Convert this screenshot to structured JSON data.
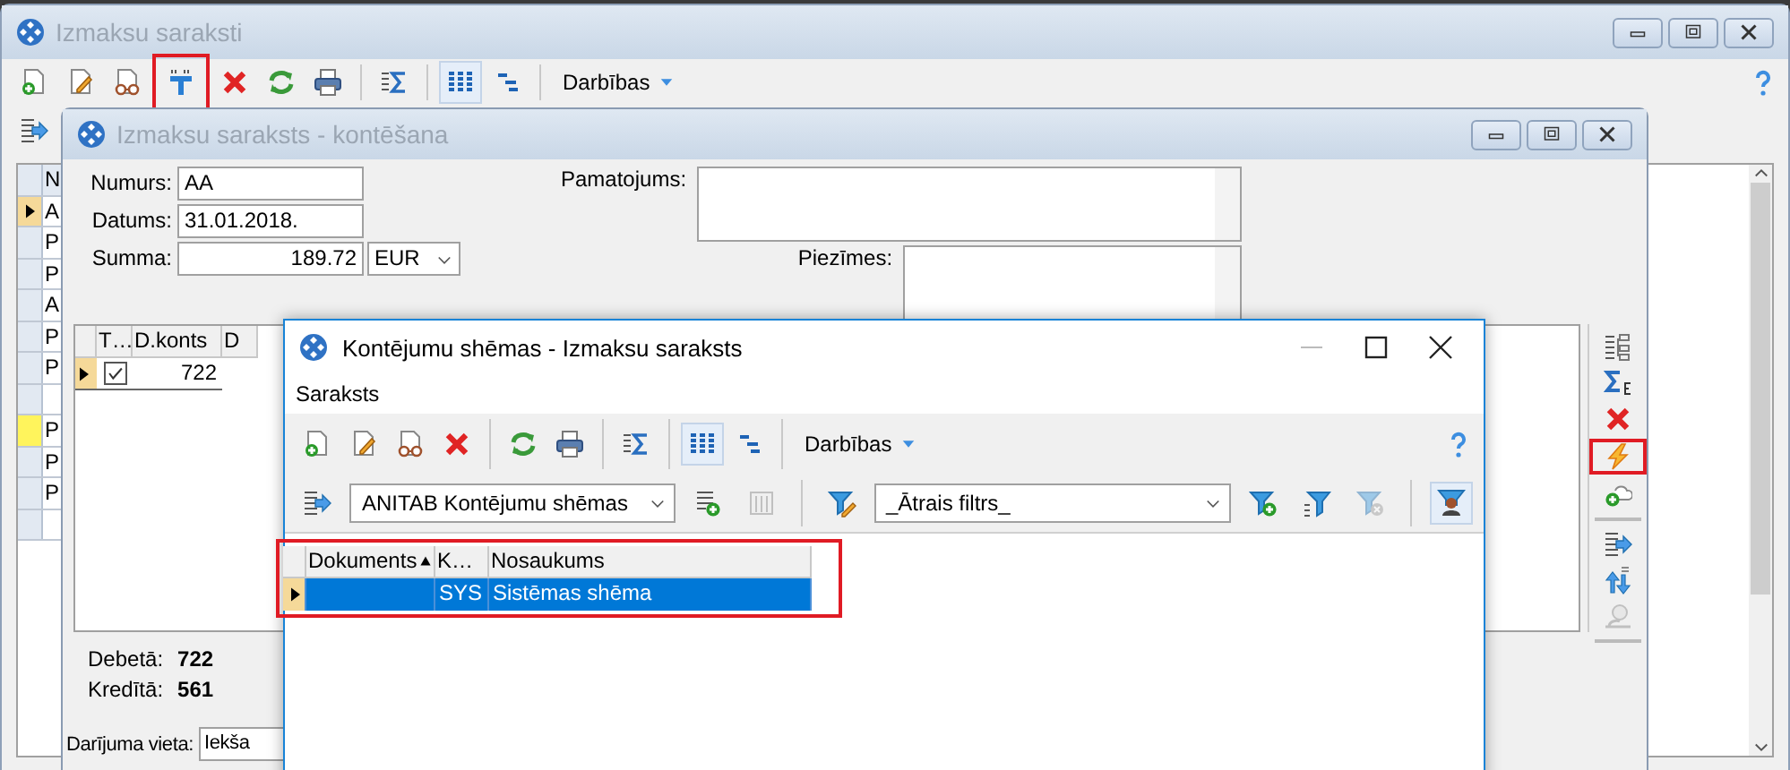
{
  "main_window": {
    "title": "Izmaksu saraksti",
    "toolbar": [
      [
        {
          "kind": "new",
          "on": false,
          "highlighted": false
        },
        {
          "kind": "edit",
          "on": false,
          "highlighted": false
        },
        {
          "kind": "view",
          "on": false,
          "highlighted": false
        },
        {
          "kind": "split",
          "on": false,
          "highlighted": true
        },
        {
          "kind": "delete",
          "on": false,
          "highlighted": false
        },
        {
          "kind": "refresh",
          "on": false,
          "highlighted": false
        },
        {
          "kind": "print",
          "on": false,
          "highlighted": false
        }
      ],
      [
        {
          "kind": "sum",
          "on": false,
          "highlighted": false
        }
      ],
      [
        {
          "kind": "columns",
          "on": true,
          "highlighted": false
        },
        {
          "kind": "tree",
          "on": false,
          "highlighted": false
        }
      ]
    ],
    "actions_menu": "Darbības",
    "secondary_toolbar": [
      {
        "kind": "list-arrow"
      }
    ],
    "list": {
      "header": "N",
      "rows": [
        {
          "text": "A",
          "selected": true,
          "flagged": false
        },
        {
          "text": "P",
          "selected": false,
          "flagged": false
        },
        {
          "text": "P",
          "selected": false,
          "flagged": false
        },
        {
          "text": "A",
          "selected": false,
          "flagged": false
        },
        {
          "text": "P",
          "selected": false,
          "flagged": false
        },
        {
          "text": "P",
          "selected": false,
          "flagged": false
        },
        {
          "selected": false,
          "flagged": false
        },
        {
          "text": "P",
          "selected": false,
          "flagged": true
        },
        {
          "text": "P",
          "selected": false,
          "flagged": false
        },
        {
          "text": "P",
          "selected": false,
          "flagged": false
        },
        {
          "selected": false,
          "flagged": false
        }
      ]
    }
  },
  "posting_window": {
    "title": "Izmaksu saraksts - kontēšana",
    "fields": [
      {
        "label": "Numurs:",
        "value": "AA"
      },
      {
        "label": "Datums:",
        "value": "31.01.2018."
      },
      {
        "label": "Summa:",
        "value": "189.72",
        "currency": "EUR"
      }
    ],
    "notes": [
      {
        "label": "Pamatojums:"
      },
      {
        "label": "Piezīmes:"
      }
    ],
    "table": {
      "columns": [
        "T…",
        "D.konts",
        "D"
      ],
      "rows": [
        {
          "selected": true,
          "checked": true,
          "d_konts": "722"
        }
      ]
    },
    "side_toolbar": [
      [
        {
          "kind": "hierarchy",
          "highlighted": false,
          "disabled": false
        },
        {
          "kind": "sum-currency",
          "highlighted": false,
          "disabled": false
        },
        {
          "kind": "delete",
          "highlighted": false,
          "disabled": false
        },
        {
          "kind": "lightning",
          "highlighted": true,
          "disabled": false
        },
        {
          "kind": "cloud-add",
          "highlighted": false,
          "disabled": false
        }
      ],
      [
        {
          "kind": "list-arrow",
          "highlighted": false,
          "disabled": false
        },
        {
          "kind": "swap",
          "highlighted": false,
          "disabled": false
        },
        {
          "kind": "magnifier",
          "highlighted": false,
          "disabled": true
        }
      ]
    ],
    "totals": [
      {
        "label": "Debetā:",
        "value": "722"
      },
      {
        "label": "Kredītā:",
        "value": "561"
      }
    ],
    "place": {
      "label": "Darījuma vieta:",
      "value": "Iekša"
    }
  },
  "schemes_window": {
    "title": "Kontējumu shēmas - Izmaksu saraksts",
    "menu": [
      "Saraksts"
    ],
    "toolbar": [
      [
        {
          "kind": "new",
          "on": false
        },
        {
          "kind": "edit",
          "on": false
        },
        {
          "kind": "view",
          "on": false
        },
        {
          "kind": "delete",
          "on": false
        }
      ],
      [
        {
          "kind": "refresh",
          "on": false
        },
        {
          "kind": "print",
          "on": false
        }
      ],
      [
        {
          "kind": "sum",
          "on": false
        }
      ],
      [
        {
          "kind": "columns",
          "on": true
        },
        {
          "kind": "tree",
          "on": false
        }
      ]
    ],
    "actions_menu": "Darbības",
    "filter_bar": [
      {
        "kind": "list-arrow",
        "on": false,
        "disabled": false
      },
      {
        "kind": "select",
        "value": "ANITAB Kontējumu shēmas"
      },
      {
        "kind": "list-add",
        "on": false,
        "disabled": false
      },
      {
        "kind": "list",
        "on": false,
        "disabled": true
      },
      {
        "kind": "separator"
      },
      {
        "kind": "filter-edit",
        "on": false,
        "disabled": false
      },
      {
        "kind": "select",
        "value": "_Ātrais filtrs_"
      },
      {
        "kind": "filter-add",
        "on": false,
        "disabled": false
      },
      {
        "kind": "filter",
        "on": false,
        "disabled": false
      },
      {
        "kind": "filter-clear",
        "on": false,
        "disabled": true
      },
      {
        "kind": "separator"
      },
      {
        "kind": "person-filter",
        "on": true,
        "disabled": false
      }
    ],
    "table": {
      "highlighted": true,
      "columns": [
        {
          "label": "Dokuments",
          "sorted": true
        },
        {
          "label": "K…",
          "sorted": false
        },
        {
          "label": "Nosaukums",
          "sorted": false
        }
      ],
      "rows": [
        {
          "selected": true,
          "cells": [
            null,
            "SYS",
            "Sistēmas shēma"
          ]
        }
      ]
    }
  }
}
